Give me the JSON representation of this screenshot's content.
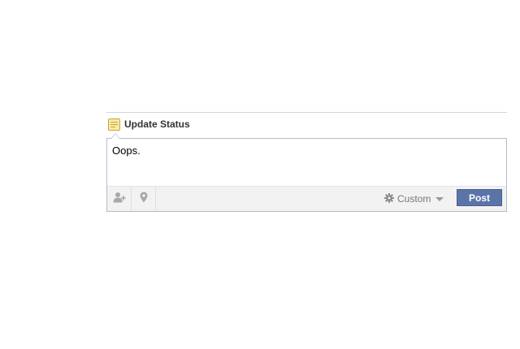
{
  "composer": {
    "tab": {
      "icon": "note-icon",
      "label": "Update Status"
    },
    "status_text": "Oops.",
    "footer": {
      "tag_friends_icon": "add-person-icon",
      "location_icon": "location-pin-icon",
      "privacy": {
        "icon": "gear-icon",
        "label": "Custom",
        "dropdown_icon": "triangle-down-icon"
      },
      "post_label": "Post"
    }
  },
  "colors": {
    "post_button": "#5b74a8",
    "footer_background": "#f2f2f2",
    "box_border": "#b4bbcd",
    "tab_icon": "#e8b830"
  }
}
